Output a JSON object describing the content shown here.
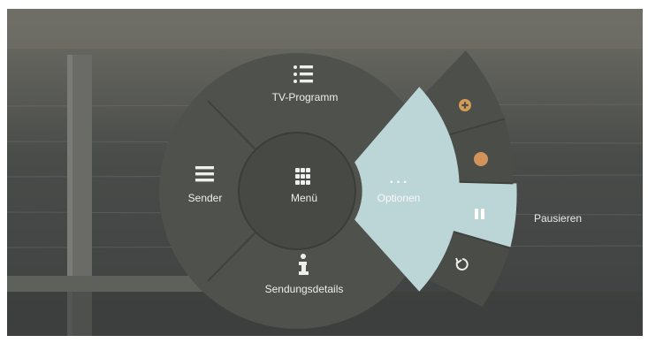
{
  "menu": {
    "center_label": "Menü",
    "top_label": "TV-Programm",
    "left_label": "Sender",
    "bottom_label": "Sendungsdetails",
    "right_label": "Optionen",
    "right_icon_text": "• • •"
  },
  "options_submenu": {
    "active_label": "Pausieren"
  },
  "colors": {
    "ring": "#4f514c",
    "center": "#474944",
    "active": "#bcd6d7",
    "icon": "#ecefec",
    "add_icon": "#d49b55",
    "record_icon": "#d2935b"
  },
  "icons": {
    "top": "list-icon",
    "left": "hamburger-icon",
    "center": "grid-icon",
    "bottom": "info-icon",
    "right": "more-dots-icon",
    "sub1": "add-circle-icon",
    "sub2": "record-icon",
    "sub3": "pause-icon",
    "sub4": "restart-icon"
  }
}
